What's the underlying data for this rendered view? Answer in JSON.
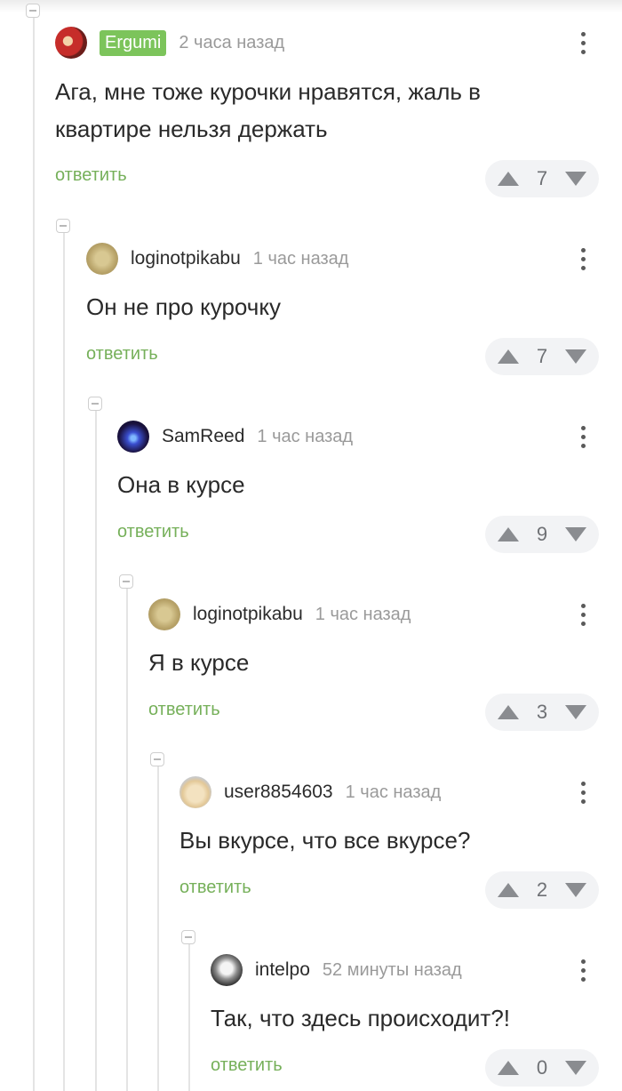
{
  "reply_label": "ответить",
  "comments": [
    {
      "username": "Ergumi",
      "time": "2 часа назад",
      "text": "Ага, мне тоже курочки нравятся, жаль в квартире нельзя держать",
      "rating": "7"
    },
    {
      "username": "loginotpikabu",
      "time": "1 час назад",
      "text": "Он не про курочку",
      "rating": "7"
    },
    {
      "username": "SamReed",
      "time": "1 час назад",
      "text": "Она в курсе",
      "rating": "9"
    },
    {
      "username": "loginotpikabu",
      "time": "1 час назад",
      "text": "Я в курсе",
      "rating": "3"
    },
    {
      "username": "user8854603",
      "time": "1 час назад",
      "text": "Вы вкурсе, что все вкурсе?",
      "rating": "2"
    },
    {
      "username": "intelpo",
      "time": "52 минуты назад",
      "text": "Так, что здесь происходит?!",
      "rating": "0"
    }
  ],
  "colors": {
    "accent_green": "#76b05a",
    "badge_green": "#7cc45b",
    "vote_bg": "#f2f3f5"
  },
  "icons": [
    "collapse-icon",
    "more-vertical-icon",
    "upvote-icon",
    "downvote-icon"
  ]
}
